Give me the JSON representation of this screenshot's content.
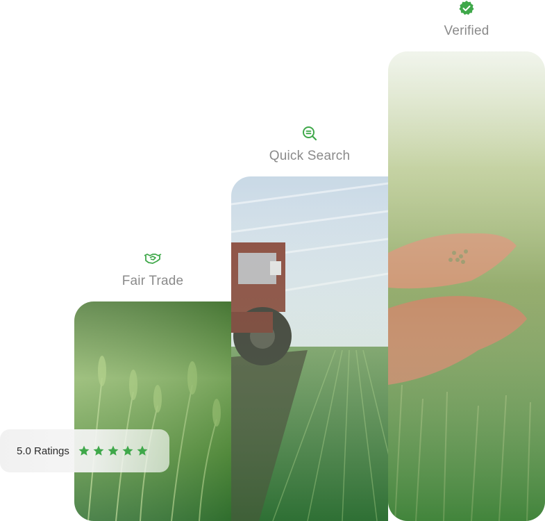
{
  "features": [
    {
      "label": "Fair Trade",
      "icon": "handshake-icon"
    },
    {
      "label": "Quick Search",
      "icon": "search-icon"
    },
    {
      "label": "Verified",
      "icon": "verified-badge-icon"
    }
  ],
  "rating": {
    "text": "5.0 Ratings",
    "stars": 5,
    "max_stars": 5
  },
  "colors": {
    "accent": "#3fa84a",
    "label_gray": "#8a8a8a"
  }
}
